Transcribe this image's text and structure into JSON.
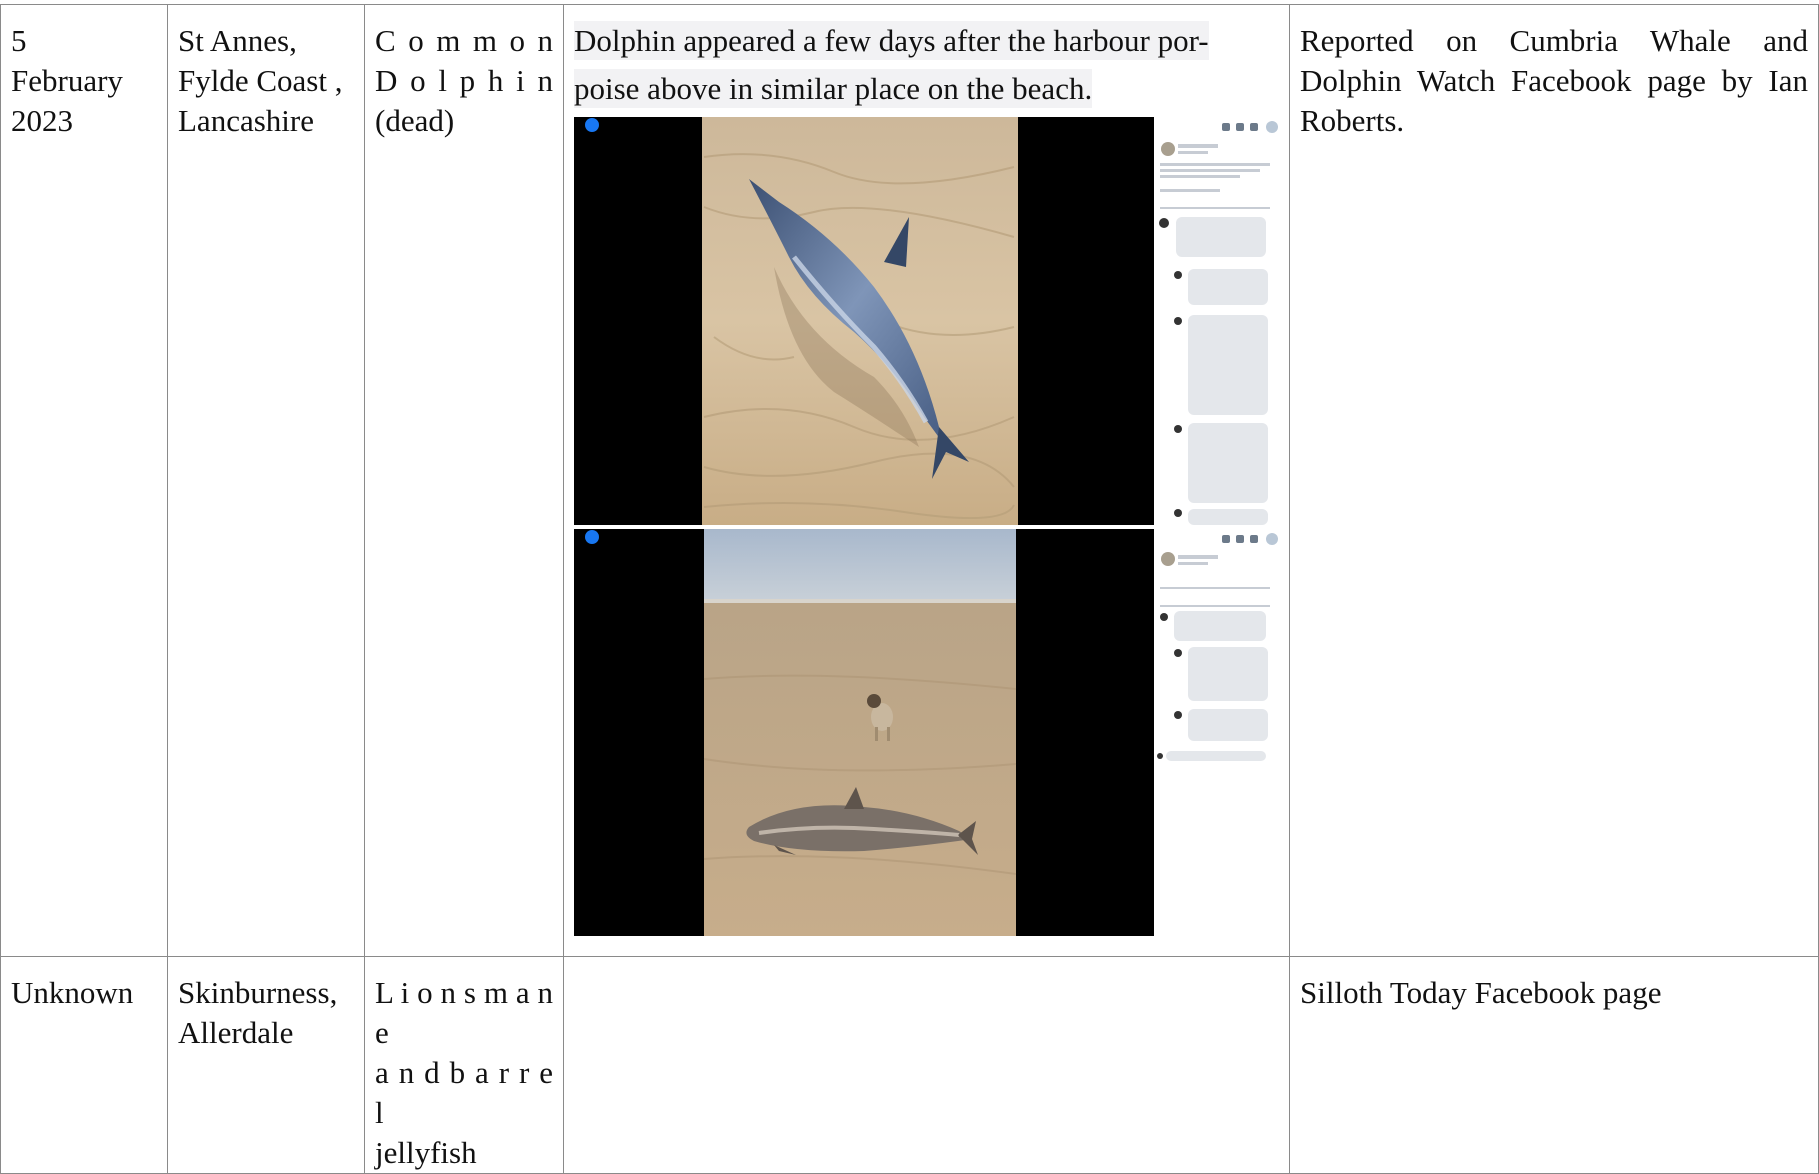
{
  "rows": [
    {
      "date": "5 February 2023",
      "date_lines": [
        "5",
        "February",
        "2023"
      ],
      "location_lines": [
        "St Annes,",
        "Fylde Coast ,",
        "Lancashire"
      ],
      "species_lines": [
        "C o m m o n",
        "D o l p h i n",
        "(dead)"
      ],
      "description": "Dolphin appeared a few days after the harbour porpoise above in similar place on the beach.",
      "description_lines": [
        "Dolphin appeared a few days after the harbour por-",
        "poise above in similar place on the beach."
      ],
      "source_lines": [
        "Reported on Cumbria Whale and",
        "Dolphin Watch Facebook page by Ian",
        "Roberts."
      ],
      "photos": [
        "dead-dolphin-on-sand-photo",
        "dead-porpoise-on-beach-with-dog-photo"
      ]
    },
    {
      "date_lines": [
        "Unknown"
      ],
      "location_lines": [
        "Skinburness,",
        "Allerdale"
      ],
      "species_lines": [
        "L i o n s m a n e",
        "a n d   b a r r e l",
        "jellyfish"
      ],
      "description": "",
      "source_lines": [
        "Silloth Today Facebook page"
      ]
    }
  ],
  "colors": {
    "border": "#8a8a8a",
    "sand": "#c9b08a",
    "sky": "#aebccc",
    "facebook_blue": "#1877f2"
  }
}
